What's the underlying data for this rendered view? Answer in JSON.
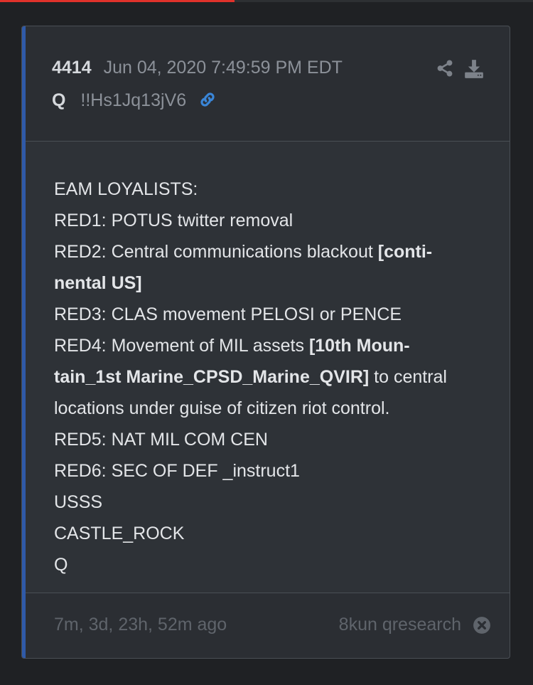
{
  "post": {
    "number": "4414",
    "timestamp": "Jun 04, 2020 7:49:59 PM EDT",
    "author": "Q",
    "tripcode": "!!Hs1Jq13jV6"
  },
  "body": {
    "l1": "EAM LOYALISTS:",
    "l2": "RED1: POTUS twitter removal",
    "l3a": "RED2: Central communications blackout ",
    "l3b": "[conti-",
    "l4": "nental US]",
    "l5": "RED3: CLAS movement PELOSI or PENCE",
    "l6a": "RED4: Movement of MIL assets ",
    "l6b": "[10th Moun-",
    "l7a": "tain_1st Marine_CPSD_Marine_QVIR]",
    "l7b": " to central",
    "l8": "locations under guise of citizen riot control.",
    "l9": "RED5: NAT MIL COM CEN",
    "l10": "RED6: SEC OF DEF _instruct1",
    "l11": "USSS",
    "l12": "CASTLE_ROCK",
    "l13": "Q"
  },
  "footer": {
    "timeago": "7m, 3d, 23h, 52m ago",
    "source": "8kun qresearch"
  },
  "icons": {
    "share": "share-icon",
    "download": "download-icon",
    "link": "link-icon",
    "close": "close-icon"
  },
  "colors": {
    "accent": "#2f5aa8",
    "link": "#3a86d8",
    "loading_bar": "#e0322b"
  },
  "loading_progress": 0.44
}
